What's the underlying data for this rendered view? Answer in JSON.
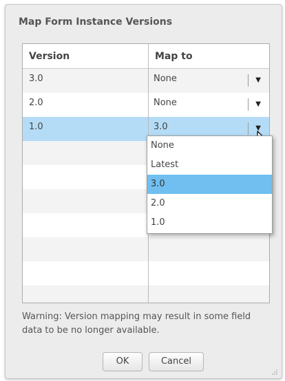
{
  "dialog": {
    "title": "Map Form Instance Versions"
  },
  "table": {
    "columns": [
      "Version",
      "Map to"
    ],
    "rows": [
      {
        "version": "3.0",
        "map_to": "None"
      },
      {
        "version": "2.0",
        "map_to": "None"
      },
      {
        "version": "1.0",
        "map_to": "3.0"
      }
    ],
    "selected_row": 2,
    "empty_rows": 7
  },
  "dropdown": {
    "options": [
      "None",
      "Latest",
      "3.0",
      "2.0",
      "1.0"
    ],
    "highlighted": "3.0"
  },
  "warning": "Warning: Version mapping may result in some field data to be no longer available.",
  "buttons": {
    "ok": "OK",
    "cancel": "Cancel"
  },
  "icons": {
    "select_arrow": "chevron-down-icon",
    "cursor": "mouse-pointer-icon",
    "grip": "resize-grip-icon"
  }
}
